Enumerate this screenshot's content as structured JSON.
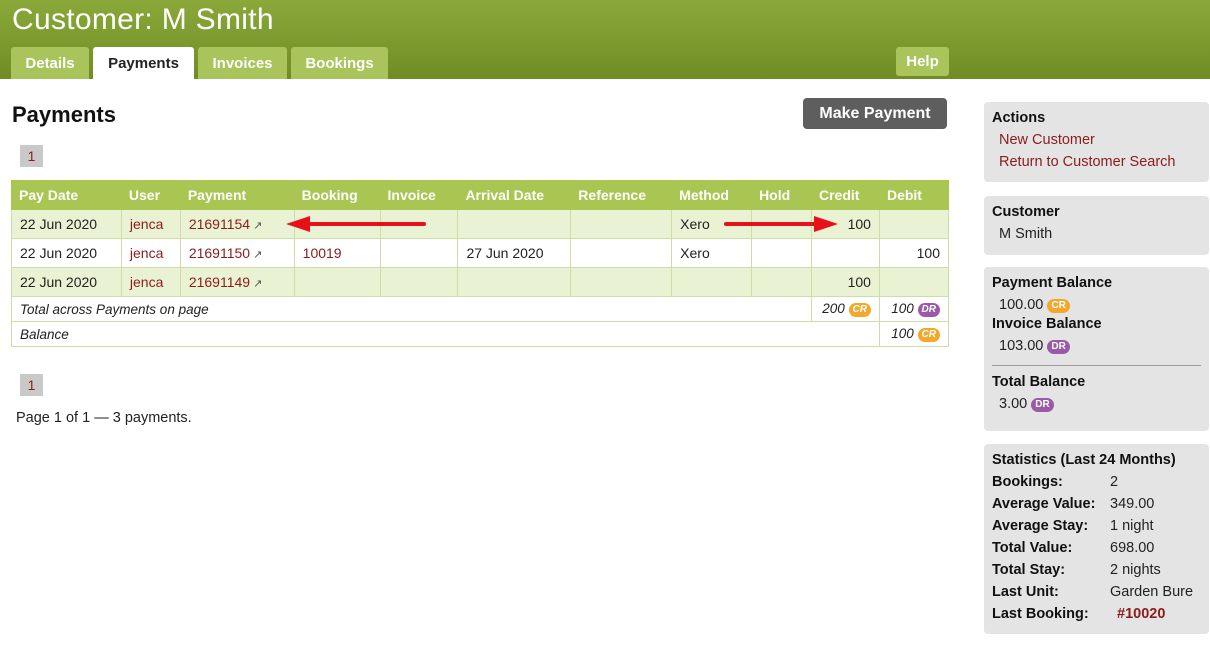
{
  "header": {
    "title": "Customer: M Smith",
    "tabs": [
      {
        "label": "Details"
      },
      {
        "label": "Payments"
      },
      {
        "label": "Invoices"
      },
      {
        "label": "Bookings"
      }
    ],
    "help_label": "Help"
  },
  "main": {
    "title": "Payments",
    "make_payment_label": "Make Payment",
    "pager_top": "1",
    "pager_bottom": "1",
    "page_info": "Page 1 of 1 — 3 payments.",
    "table": {
      "columns": [
        "Pay Date",
        "User",
        "Payment",
        "Booking",
        "Invoice",
        "Arrival Date",
        "Reference",
        "Method",
        "Hold",
        "Credit",
        "Debit"
      ],
      "rows": [
        {
          "pay_date": "22 Jun 2020",
          "user": "jenca",
          "payment": "21691154",
          "booking": "",
          "invoice": "",
          "arrival_date": "",
          "reference": "",
          "method": "Xero",
          "hold": "",
          "credit": "100",
          "debit": ""
        },
        {
          "pay_date": "22 Jun 2020",
          "user": "jenca",
          "payment": "21691150",
          "booking": "10019",
          "invoice": "",
          "arrival_date": "27 Jun 2020",
          "reference": "",
          "method": "Xero",
          "hold": "",
          "credit": "",
          "debit": "100"
        },
        {
          "pay_date": "22 Jun 2020",
          "user": "jenca",
          "payment": "21691149",
          "booking": "",
          "invoice": "",
          "arrival_date": "",
          "reference": "",
          "method": "",
          "hold": "",
          "credit": "100",
          "debit": ""
        }
      ],
      "total_label": "Total across Payments on page",
      "total_credit": "200",
      "total_credit_badge": "CR",
      "total_debit": "100",
      "total_debit_badge": "DR",
      "balance_label": "Balance",
      "balance_value": "100",
      "balance_badge": "CR"
    }
  },
  "sidebar": {
    "actions": {
      "title": "Actions",
      "links": [
        "New Customer",
        "Return to Customer Search"
      ]
    },
    "customer": {
      "title": "Customer",
      "name": "M Smith"
    },
    "balances": {
      "payment_title": "Payment Balance",
      "payment_value": "100.00",
      "payment_badge": "CR",
      "invoice_title": "Invoice Balance",
      "invoice_value": "103.00",
      "invoice_badge": "DR",
      "total_title": "Total Balance",
      "total_value": "3.00",
      "total_badge": "DR"
    },
    "statistics": {
      "title": "Statistics (Last 24 Months)",
      "rows": [
        {
          "label": "Bookings:",
          "value": "2"
        },
        {
          "label": "Average Value:",
          "value": "349.00"
        },
        {
          "label": "Average Stay:",
          "value": "1 night"
        },
        {
          "label": "Total Value:",
          "value": "698.00"
        },
        {
          "label": "Total Stay:",
          "value": "2 nights"
        },
        {
          "label": "Last Unit:",
          "value": "Garden Bure"
        },
        {
          "label": "Last Booking:",
          "value": "#10020"
        }
      ]
    }
  },
  "colors": {
    "header": "#7a9a2c",
    "tab": "#a8c45a",
    "link": "#8a1c1c",
    "cr_badge": "#f3a72b",
    "dr_badge": "#9b5aa8",
    "arrow": "#e8101a"
  }
}
